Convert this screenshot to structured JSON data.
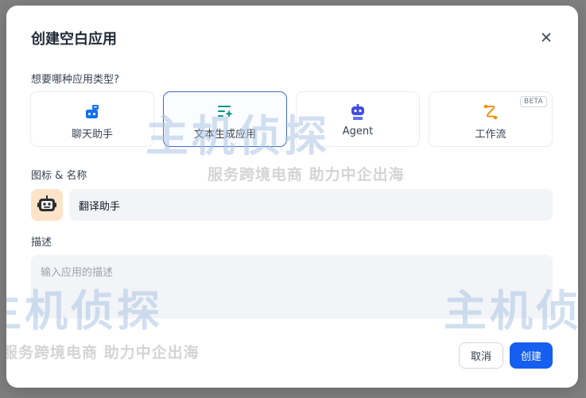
{
  "dialog": {
    "title": "创建空白应用",
    "close_symbol": "×"
  },
  "app_type": {
    "label": "想要哪种应用类型?",
    "options": [
      {
        "label": "聊天助手",
        "icon": "chat-bot-icon",
        "color": "#1570ef"
      },
      {
        "label": "文本生成应用",
        "icon": "text-generate-icon",
        "color": "#0e9384",
        "selected": true
      },
      {
        "label": "Agent",
        "icon": "agent-robot-icon",
        "color": "#444ce7"
      },
      {
        "label": "工作流",
        "icon": "workflow-icon",
        "color": "#f79009",
        "badge": "BETA"
      }
    ]
  },
  "icon_name": {
    "label": "图标 & 名称",
    "value": "翻译助手"
  },
  "description": {
    "label": "描述",
    "placeholder": "输入应用的描述"
  },
  "buttons": {
    "cancel": "取消",
    "create": "创建"
  },
  "watermark": {
    "brand": "主机侦探",
    "slogan": "服务跨境电商 助力中企出海"
  }
}
